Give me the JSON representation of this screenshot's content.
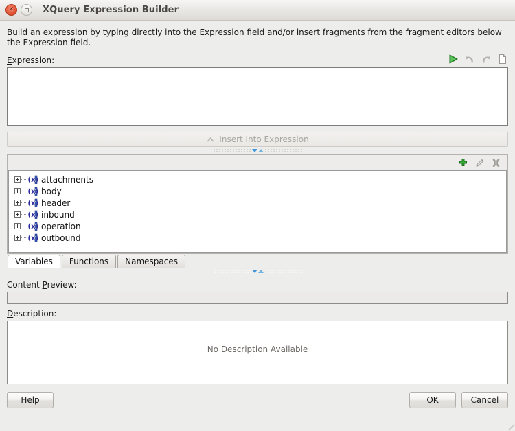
{
  "window": {
    "title": "XQuery Expression Builder",
    "close_icon": "close-icon",
    "maximize_icon": "maximize-icon"
  },
  "intro": {
    "text": "Build an expression by typing directly into the Expression field and/or insert fragments from the fragment editors below the Expression field."
  },
  "expression": {
    "label": "Expression:",
    "label_mnemonic": "E",
    "label_rest": "xpression:",
    "value": "",
    "toolbar": [
      {
        "name": "run-icon",
        "title": "Run"
      },
      {
        "name": "undo-icon",
        "title": "Undo"
      },
      {
        "name": "redo-icon",
        "title": "Redo"
      },
      {
        "name": "new-document-icon",
        "title": "Clear"
      }
    ]
  },
  "insert_button": {
    "label": "Insert Into Expression",
    "icon": "chevron-up-icon",
    "enabled": false
  },
  "fragment_panel": {
    "toolbar": [
      {
        "name": "add-icon",
        "title": "Add"
      },
      {
        "name": "edit-icon",
        "title": "Edit"
      },
      {
        "name": "delete-icon",
        "title": "Delete"
      }
    ],
    "tree_items": [
      {
        "label": "attachments",
        "icon": "variable-icon",
        "expandable": true
      },
      {
        "label": "body",
        "icon": "variable-icon",
        "expandable": true
      },
      {
        "label": "header",
        "icon": "variable-icon",
        "expandable": true
      },
      {
        "label": "inbound",
        "icon": "variable-icon",
        "expandable": true
      },
      {
        "label": "operation",
        "icon": "variable-icon",
        "expandable": true
      },
      {
        "label": "outbound",
        "icon": "variable-icon",
        "expandable": true
      }
    ],
    "tabs": [
      {
        "label": "Variables",
        "active": true
      },
      {
        "label": "Functions",
        "active": false
      },
      {
        "label": "Namespaces",
        "active": false
      }
    ]
  },
  "content_preview": {
    "label_pre": "Content ",
    "label_mnemonic": "P",
    "label_rest": "review:",
    "value": ""
  },
  "description": {
    "label_mnemonic": "D",
    "label_rest": "escription:",
    "placeholder": "No Description Available"
  },
  "footer": {
    "help": {
      "mnemonic": "H",
      "rest": "elp"
    },
    "ok": "OK",
    "cancel": "Cancel"
  },
  "colors": {
    "accent_green": "#2f9e34",
    "accent_blue": "#3f95d8",
    "window_bg": "#ededeb",
    "field_bg": "#ffffff",
    "disabled_text": "#a9a6a2"
  }
}
